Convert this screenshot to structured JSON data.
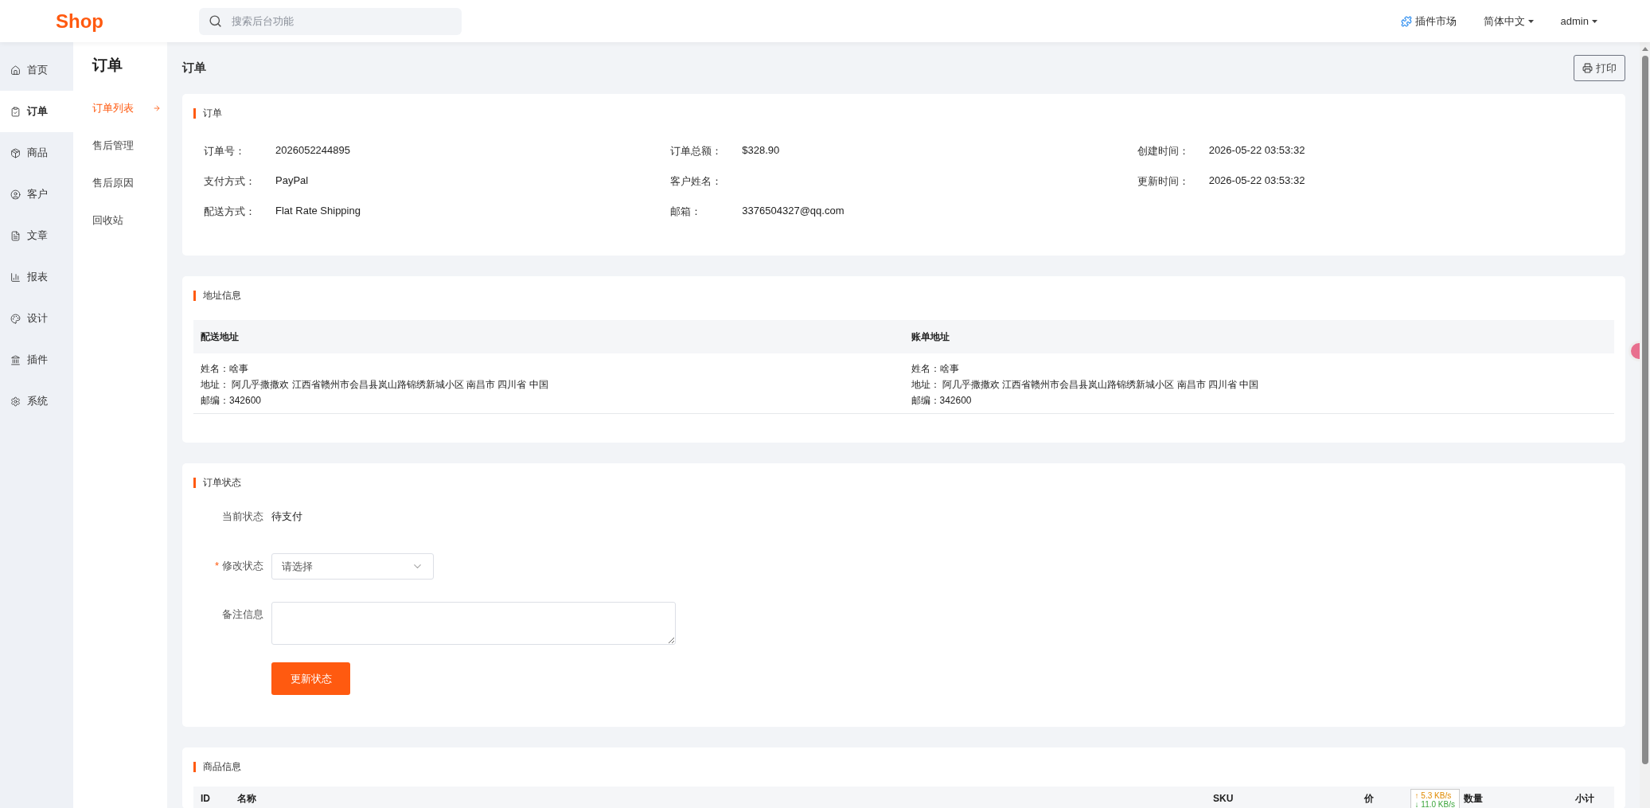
{
  "header": {
    "logo": "Shop",
    "search": {
      "placeholder": "搜索后台功能"
    },
    "links": [
      {
        "kind": "plugin",
        "label": "插件市场"
      },
      {
        "kind": "dropdown",
        "label": "简体中文"
      },
      {
        "kind": "dropdown",
        "label": "admin"
      }
    ]
  },
  "nav": [
    {
      "label": "首页",
      "selected": false
    },
    {
      "label": "订单",
      "selected": true
    },
    {
      "label": "商品",
      "selected": false
    },
    {
      "label": "客户",
      "selected": false
    },
    {
      "label": "文章",
      "selected": false
    },
    {
      "label": "报表",
      "selected": false
    },
    {
      "label": "设计",
      "selected": false
    },
    {
      "label": "插件",
      "selected": false
    },
    {
      "label": "系统",
      "selected": false
    }
  ],
  "subnav": {
    "title": "订单",
    "items": [
      {
        "label": "订单列表",
        "selected": true
      },
      {
        "label": "售后管理",
        "selected": false
      },
      {
        "label": "售后原因",
        "selected": false
      },
      {
        "label": "回收站",
        "selected": false
      }
    ]
  },
  "page": {
    "title": "订单",
    "print_button": "打印"
  },
  "order_card": {
    "title": "订单",
    "fields": [
      {
        "label": "订单号：",
        "value": "2026052244895"
      },
      {
        "label": "订单总额：",
        "value": "$328.90"
      },
      {
        "label": "创建时间：",
        "value": "2026-05-22 03:53:32"
      },
      {
        "label": "支付方式：",
        "value": "PayPal"
      },
      {
        "label": "客户姓名："
      },
      {
        "label": "更新时间：",
        "value": "2026-05-22 03:53:32"
      },
      {
        "label": "配送方式：",
        "value": "Flat Rate Shipping"
      },
      {
        "label": "邮箱：",
        "value": "3376504327@qq.com"
      }
    ]
  },
  "address_card": {
    "title": "地址信息",
    "columns": [
      {
        "heading": "配送地址",
        "lines": [
          "姓名：啥事",
          "地址： 阿几乎撒撒欢 江西省赣州市会昌县岚山路锦绣新城小区 南昌市 四川省 中国",
          "邮编：342600"
        ]
      },
      {
        "heading": "账单地址",
        "lines": [
          "姓名：啥事",
          "地址： 阿几乎撒撒欢 江西省赣州市会昌县岚山路锦绣新城小区 南昌市 四川省 中国",
          "邮编：342600"
        ]
      }
    ]
  },
  "status_card": {
    "title": "订单状态",
    "current": {
      "label": "当前状态",
      "value": "待支付"
    },
    "change": {
      "label": "修改状态",
      "required_mark": "*",
      "placeholder": "请选择"
    },
    "note": {
      "label": "备注信息"
    },
    "submit": "更新状态"
  },
  "products_card": {
    "title": "商品信息",
    "columns": [
      "ID",
      "名称",
      "SKU",
      "价",
      "数量",
      "小计"
    ]
  },
  "net_speed": {
    "up": "↑ 5.3 KB/s",
    "down": "↓ 11.0 KB/s"
  }
}
